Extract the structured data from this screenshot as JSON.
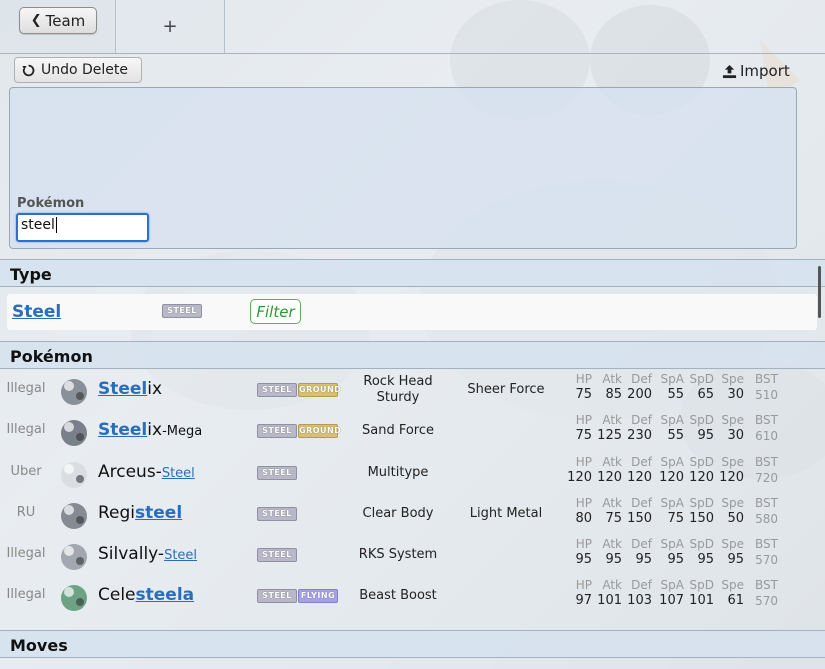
{
  "colors": {
    "link": "#2a6ebb",
    "filter": "#2d9a2d",
    "steel": "#b8b8c8",
    "ground": "#d8c070",
    "flying": "#a6a0e8"
  },
  "topbar": {
    "team_label": "Team",
    "back_icon": "chevron-left-icon",
    "new_tab_label": "+"
  },
  "toolbar": {
    "undo_label": "Undo Delete",
    "undo_icon": "undo-icon",
    "import_label": "Import",
    "import_icon": "upload-icon"
  },
  "editor": {
    "pokemon_label": "Pokémon",
    "search_value": "steel"
  },
  "sections": {
    "type": "Type",
    "pokemon": "Pokémon",
    "moves": "Moves"
  },
  "type_result": {
    "name": "Steel",
    "badge": "STEEL",
    "filter_label": "Filter"
  },
  "stat_labels": [
    "HP",
    "Atk",
    "Def",
    "SpA",
    "SpD",
    "Spe",
    "BST"
  ],
  "pokemon": [
    {
      "tier": "Illegal",
      "name_hl": "Steel",
      "name_rest": "ix",
      "name_suffix": "",
      "types": [
        "STEEL",
        "GROUND"
      ],
      "ability1": "Rock Head",
      "ability1b": "Sturdy",
      "ability2": "Sheer Force",
      "stats": [
        "75",
        "85",
        "200",
        "55",
        "65",
        "30",
        "510"
      ]
    },
    {
      "tier": "Illegal",
      "name_hl": "Steel",
      "name_rest": "ix",
      "name_suffix": "-Mega",
      "types": [
        "STEEL",
        "GROUND"
      ],
      "ability1": "Sand Force",
      "ability1b": "",
      "ability2": "",
      "stats": [
        "75",
        "125",
        "230",
        "55",
        "95",
        "30",
        "610"
      ]
    },
    {
      "tier": "Uber",
      "name_pre": "Arceus-",
      "name_hl_small": "Steel",
      "types": [
        "STEEL"
      ],
      "ability1": "Multitype",
      "ability1b": "",
      "ability2": "",
      "stats": [
        "120",
        "120",
        "120",
        "120",
        "120",
        "120",
        "720"
      ]
    },
    {
      "tier": "RU",
      "name_pre": "Regi",
      "name_hl": "steel",
      "types": [
        "STEEL"
      ],
      "ability1": "Clear Body",
      "ability1b": "",
      "ability2": "Light Metal",
      "stats": [
        "80",
        "75",
        "150",
        "75",
        "150",
        "50",
        "580"
      ]
    },
    {
      "tier": "Illegal",
      "name_pre": "Silvally-",
      "name_hl_small": "Steel",
      "types": [
        "STEEL"
      ],
      "ability1": "RKS System",
      "ability1b": "",
      "ability2": "",
      "stats": [
        "95",
        "95",
        "95",
        "95",
        "95",
        "95",
        "570"
      ]
    },
    {
      "tier": "Illegal",
      "name_pre": "Cele",
      "name_hl": "steela",
      "types": [
        "STEEL",
        "FLYING"
      ],
      "ability1": "Beast Boost",
      "ability1b": "",
      "ability2": "",
      "stats": [
        "97",
        "101",
        "103",
        "107",
        "101",
        "61",
        "570"
      ]
    }
  ]
}
